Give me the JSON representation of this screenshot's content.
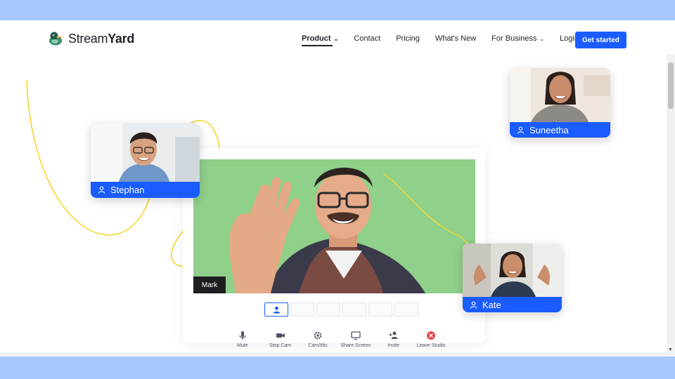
{
  "brand": {
    "name_prefix": "Stream",
    "name_suffix": "Yard",
    "accent": "#1a5cff"
  },
  "nav": {
    "items": [
      {
        "label": "Product",
        "active": true,
        "has_menu": true
      },
      {
        "label": "Contact",
        "active": false,
        "has_menu": false
      },
      {
        "label": "Pricing",
        "active": false,
        "has_menu": false
      },
      {
        "label": "What's New",
        "active": false,
        "has_menu": false
      },
      {
        "label": "For Business",
        "active": false,
        "has_menu": true
      },
      {
        "label": "Login",
        "active": false,
        "has_menu": false
      }
    ],
    "cta_label": "Get started"
  },
  "hero": {
    "main_speaker": "Mark",
    "guests": {
      "stephan": "Stephan",
      "suneetha": "Suneetha",
      "kate": "Kate"
    },
    "controls": [
      "Mute",
      "Stop Cam",
      "Cam/Mic",
      "Share Screen",
      "Invite",
      "Leave Studio"
    ]
  }
}
